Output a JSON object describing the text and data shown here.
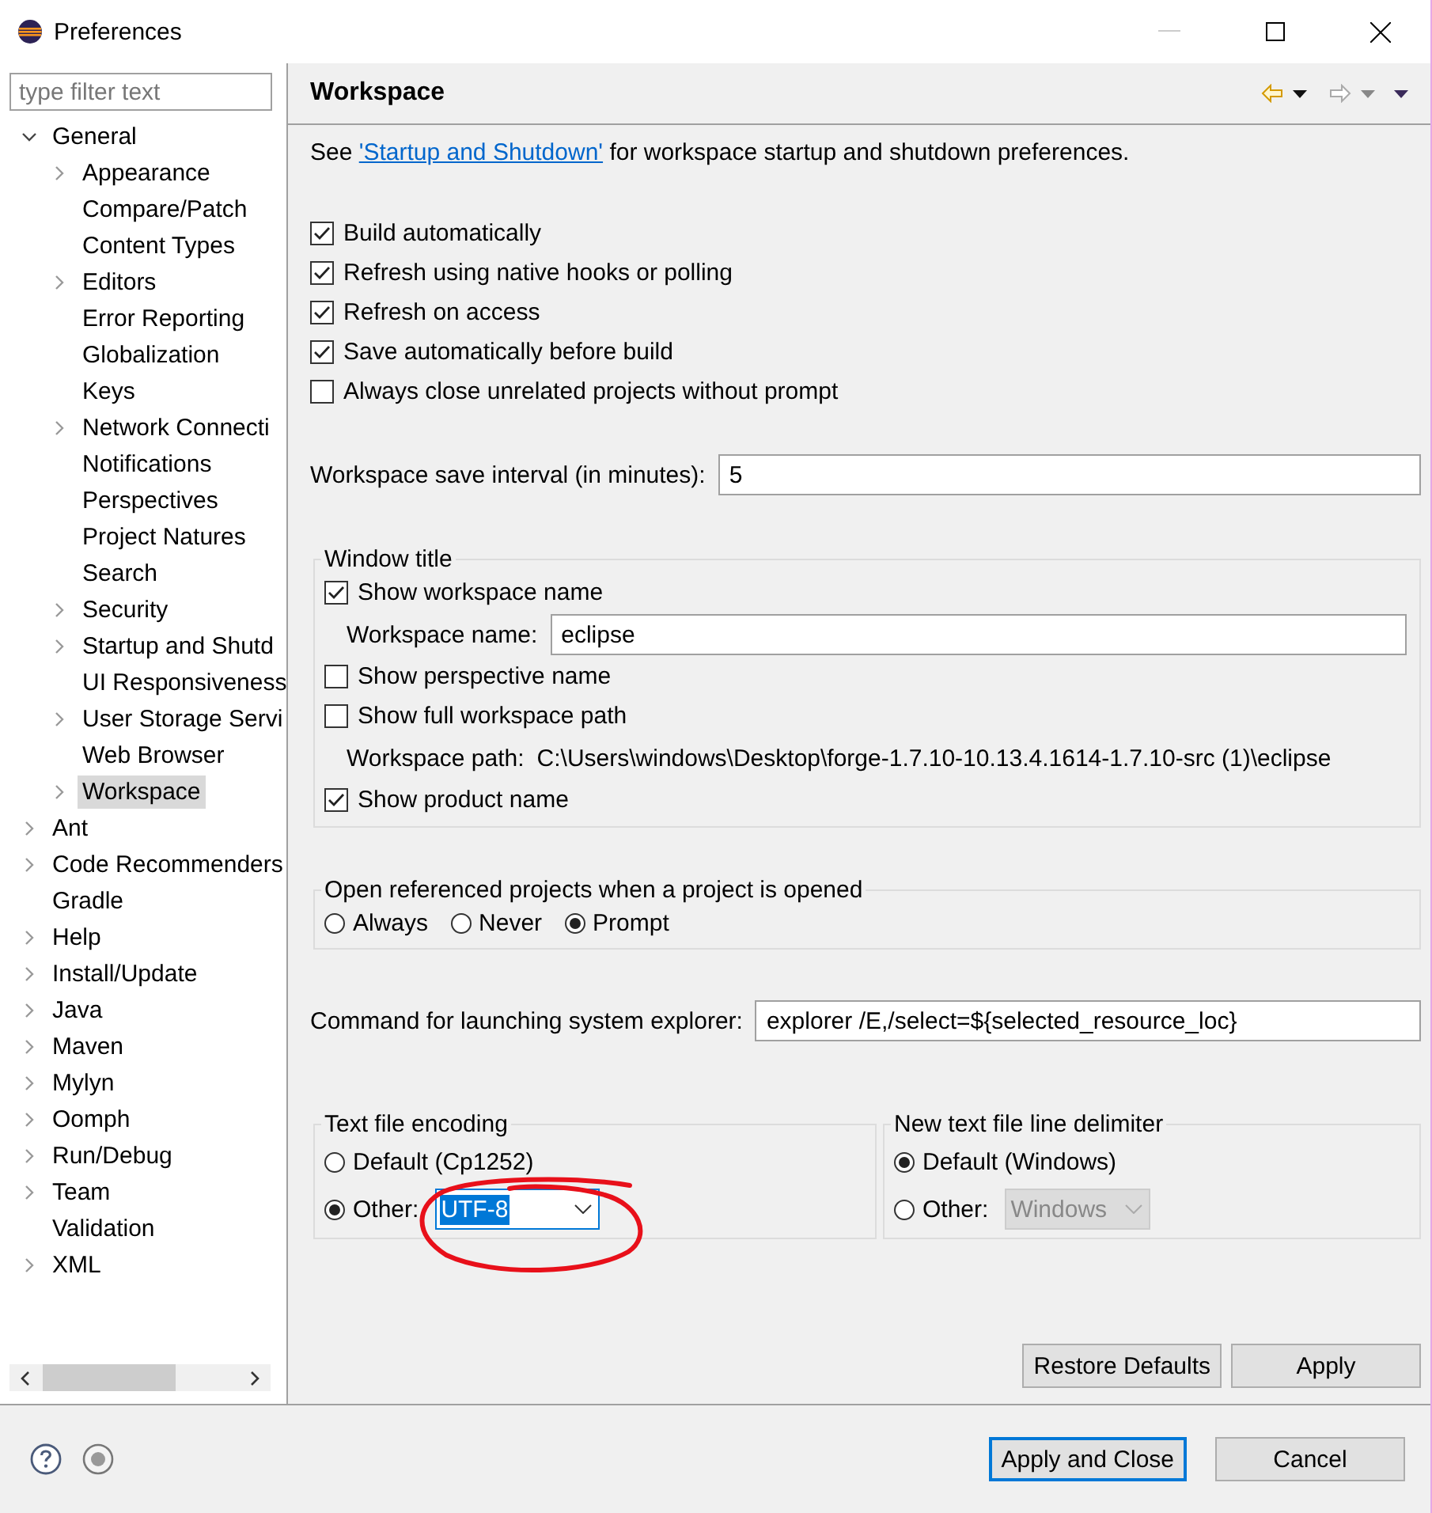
{
  "window": {
    "title": "Preferences"
  },
  "filter": {
    "placeholder": "type filter text"
  },
  "tree": [
    {
      "label": "General",
      "kind": "expanded",
      "selected": false,
      "children": [
        {
          "label": "Appearance",
          "kind": "collapsed",
          "selected": false
        },
        {
          "label": "Compare/Patch",
          "kind": "leaf",
          "selected": false
        },
        {
          "label": "Content Types",
          "kind": "leaf",
          "selected": false
        },
        {
          "label": "Editors",
          "kind": "collapsed",
          "selected": false
        },
        {
          "label": "Error Reporting",
          "kind": "leaf",
          "selected": false
        },
        {
          "label": "Globalization",
          "kind": "leaf",
          "selected": false
        },
        {
          "label": "Keys",
          "kind": "leaf",
          "selected": false
        },
        {
          "label": "Network Connecti",
          "kind": "collapsed",
          "selected": false
        },
        {
          "label": "Notifications",
          "kind": "leaf",
          "selected": false
        },
        {
          "label": "Perspectives",
          "kind": "leaf",
          "selected": false
        },
        {
          "label": "Project Natures",
          "kind": "leaf",
          "selected": false
        },
        {
          "label": "Search",
          "kind": "leaf",
          "selected": false
        },
        {
          "label": "Security",
          "kind": "collapsed",
          "selected": false
        },
        {
          "label": "Startup and Shutd",
          "kind": "collapsed",
          "selected": false
        },
        {
          "label": "UI Responsiveness",
          "kind": "leaf",
          "selected": false
        },
        {
          "label": "User Storage Servi",
          "kind": "collapsed",
          "selected": false
        },
        {
          "label": "Web Browser",
          "kind": "leaf",
          "selected": false
        },
        {
          "label": "Workspace",
          "kind": "collapsed",
          "selected": true
        }
      ]
    },
    {
      "label": "Ant",
      "kind": "collapsed",
      "selected": false
    },
    {
      "label": "Code Recommenders",
      "kind": "collapsed",
      "selected": false
    },
    {
      "label": "Gradle",
      "kind": "leaf",
      "selected": false
    },
    {
      "label": "Help",
      "kind": "collapsed",
      "selected": false
    },
    {
      "label": "Install/Update",
      "kind": "collapsed",
      "selected": false
    },
    {
      "label": "Java",
      "kind": "collapsed",
      "selected": false
    },
    {
      "label": "Maven",
      "kind": "collapsed",
      "selected": false
    },
    {
      "label": "Mylyn",
      "kind": "collapsed",
      "selected": false
    },
    {
      "label": "Oomph",
      "kind": "collapsed",
      "selected": false
    },
    {
      "label": "Run/Debug",
      "kind": "collapsed",
      "selected": false
    },
    {
      "label": "Team",
      "kind": "collapsed",
      "selected": false
    },
    {
      "label": "Validation",
      "kind": "leaf",
      "selected": false
    },
    {
      "label": "XML",
      "kind": "collapsed",
      "selected": false
    }
  ],
  "page": {
    "title": "Workspace",
    "intro_before": "See ",
    "intro_link": "'Startup and Shutdown'",
    "intro_after": " for workspace startup and shutdown preferences.",
    "options": [
      {
        "label": "Build automatically",
        "checked": true
      },
      {
        "label": "Refresh using native hooks or polling",
        "checked": true
      },
      {
        "label": "Refresh on access",
        "checked": true
      },
      {
        "label": "Save automatically before build",
        "checked": true
      },
      {
        "label": "Always close unrelated projects without prompt",
        "checked": false
      }
    ],
    "save_interval": {
      "label": "Workspace save interval (in minutes):",
      "value": "5"
    },
    "window_title": {
      "title": "Window title",
      "items": [
        {
          "kind": "checkbox",
          "label": "Show workspace name",
          "checked": true
        },
        {
          "kind": "field",
          "label": "Workspace name:",
          "value": "eclipse"
        },
        {
          "kind": "checkbox",
          "label": "Show perspective name",
          "checked": false
        },
        {
          "kind": "checkbox",
          "label": "Show full workspace path",
          "checked": false
        },
        {
          "kind": "text",
          "label": "Workspace path:",
          "value": "C:\\Users\\windows\\Desktop\\forge-1.7.10-10.13.4.1614-1.7.10-src (1)\\eclipse"
        },
        {
          "kind": "checkbox",
          "label": "Show product name",
          "checked": true
        }
      ]
    },
    "open_projects": {
      "title": "Open referenced projects when a project is opened",
      "choices": [
        {
          "label": "Always",
          "selected": false
        },
        {
          "label": "Never",
          "selected": false
        },
        {
          "label": "Prompt",
          "selected": true
        }
      ]
    },
    "command": {
      "label": "Command for launching system explorer:",
      "value": "explorer /E,/select=${selected_resource_loc}"
    },
    "encoding": {
      "title": "Text file encoding",
      "choices": [
        {
          "label": "Default (Cp1252)",
          "selected": false
        },
        {
          "label": "Other:",
          "selected": true,
          "combo": "UTF-8",
          "disabled": false,
          "text_selected": true
        }
      ]
    },
    "delimiter": {
      "title": "New text file line delimiter",
      "choices": [
        {
          "label": "Default (Windows)",
          "selected": true
        },
        {
          "label": "Other:",
          "selected": false,
          "combo": "Windows",
          "disabled": true,
          "text_selected": false
        }
      ]
    },
    "page_buttons": [
      "Restore Defaults",
      "Apply"
    ]
  },
  "annotation_circle": true,
  "footer_buttons": [
    {
      "label": "Apply and Close",
      "default": true
    },
    {
      "label": "Cancel",
      "default": false
    }
  ]
}
